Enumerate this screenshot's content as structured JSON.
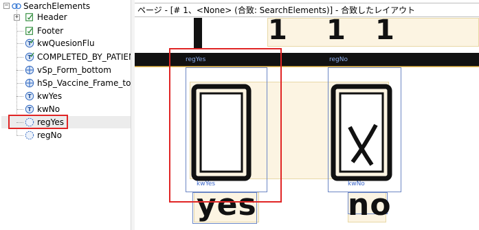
{
  "tree": {
    "root": {
      "label": "SearchElements",
      "icon": "search-elements-icon"
    },
    "items": [
      {
        "label": "Header",
        "icon": "header-check-icon",
        "expandable": true
      },
      {
        "label": "Footer",
        "icon": "footer-check-icon",
        "expandable": false
      },
      {
        "label": "kwQuesionFlu",
        "icon": "keyword-check-icon",
        "expandable": false
      },
      {
        "label": "COMPLETED_BY_PATIENT",
        "icon": "keyword-check-icon",
        "expandable": false
      },
      {
        "label": "vSp_Form_bottom",
        "icon": "separator-icon",
        "expandable": false
      },
      {
        "label": "hSp_Vaccine_Frame_top",
        "icon": "separator-icon",
        "expandable": false
      },
      {
        "label": "kwYes",
        "icon": "keyword-icon",
        "expandable": false
      },
      {
        "label": "kwNo",
        "icon": "keyword-icon",
        "expandable": false
      },
      {
        "label": "regYes",
        "icon": "region-icon",
        "expandable": false,
        "selected": true
      },
      {
        "label": "regNo",
        "icon": "region-icon",
        "expandable": false
      }
    ]
  },
  "view": {
    "title": "ページ - [# 1、<None> (合致: SearchElements)] - 合致したレイアウト",
    "top_digits": [
      "1",
      "1",
      "1"
    ],
    "region_labels": {
      "regYes": "regYes",
      "regNo": "regNo",
      "kwYes": "kwYes",
      "kwNo": "kwNo"
    },
    "words": {
      "yes": "yes",
      "no": "no"
    }
  },
  "colors": {
    "highlight_red": "#e02424",
    "region_blue": "#3b66c9",
    "match_beige": "#fcf4e2"
  }
}
